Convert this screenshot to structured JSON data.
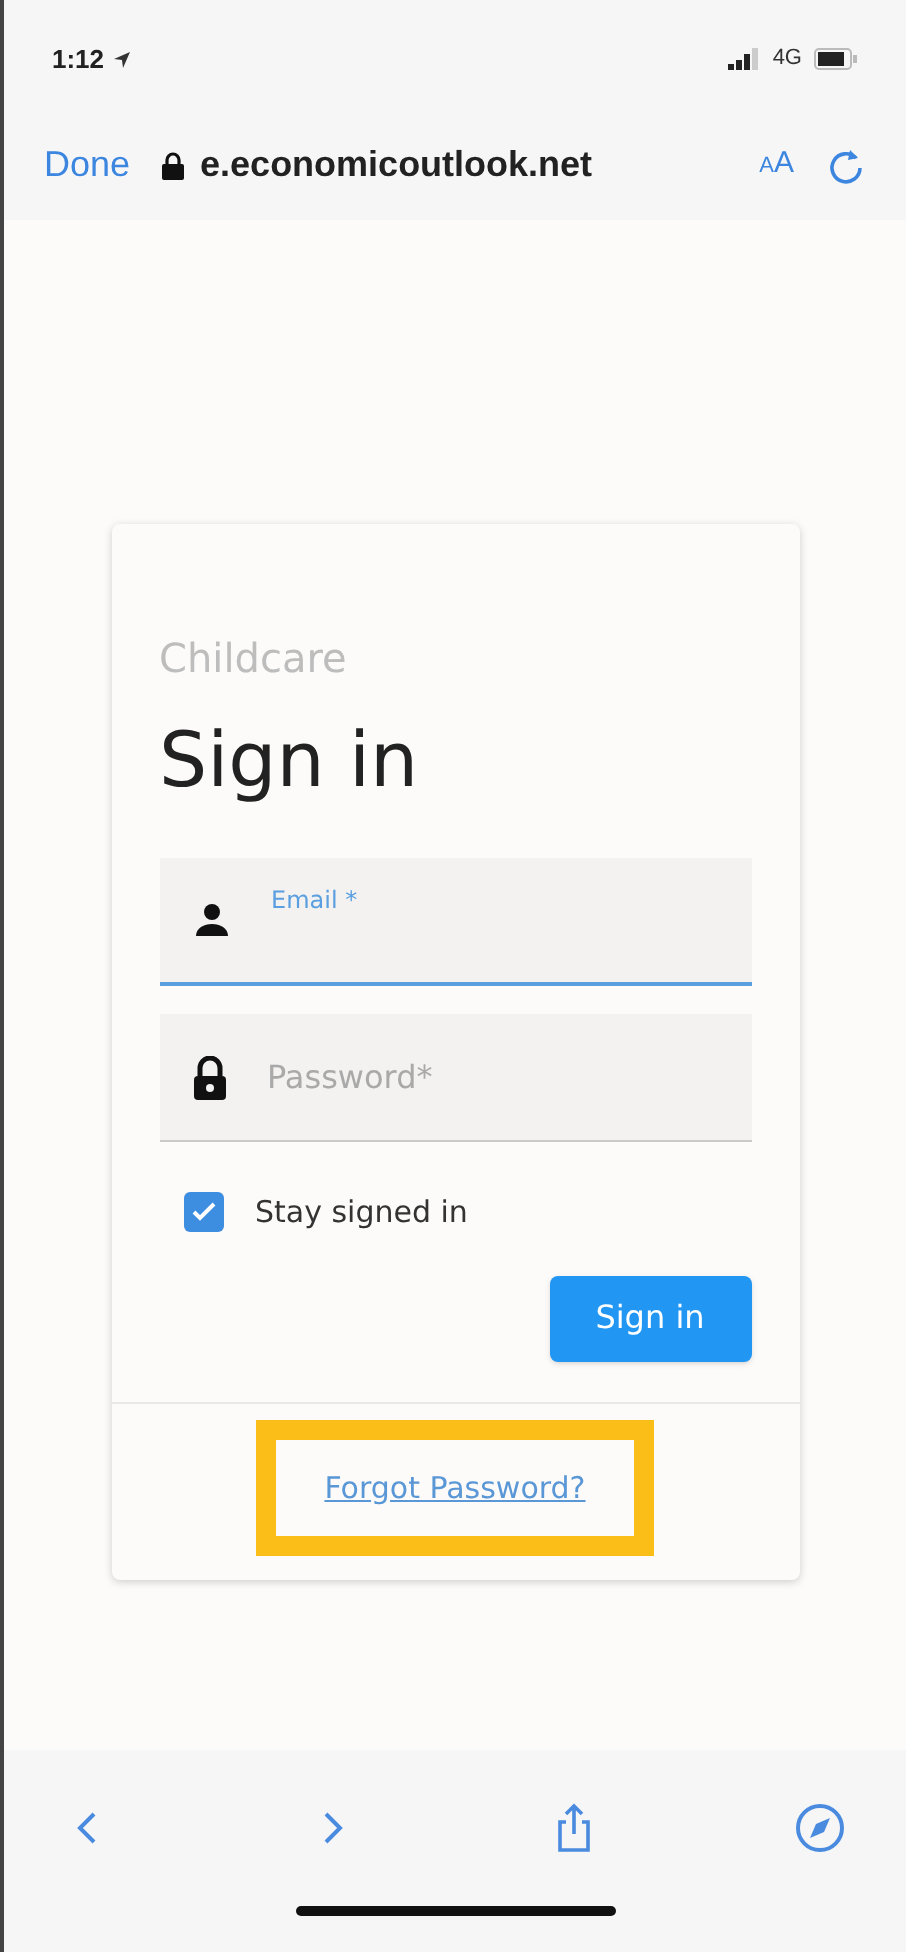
{
  "status_bar": {
    "time": "1:12",
    "network": "4G"
  },
  "browser_bar": {
    "done": "Done",
    "url": "e.economicoutlook.net",
    "text_size": [
      "A",
      "A"
    ]
  },
  "card": {
    "app_name": "Childcare",
    "title": "Sign in",
    "fields": [
      {
        "kind": "email",
        "label": "Email *",
        "focused": true
      },
      {
        "kind": "password",
        "label": "Password*",
        "focused": false
      }
    ],
    "stay_signed_in": {
      "label": "Stay signed in",
      "checked": true
    },
    "submit": "Sign in",
    "forgot": {
      "label": "Forgot Password?",
      "highlighted": true
    }
  }
}
